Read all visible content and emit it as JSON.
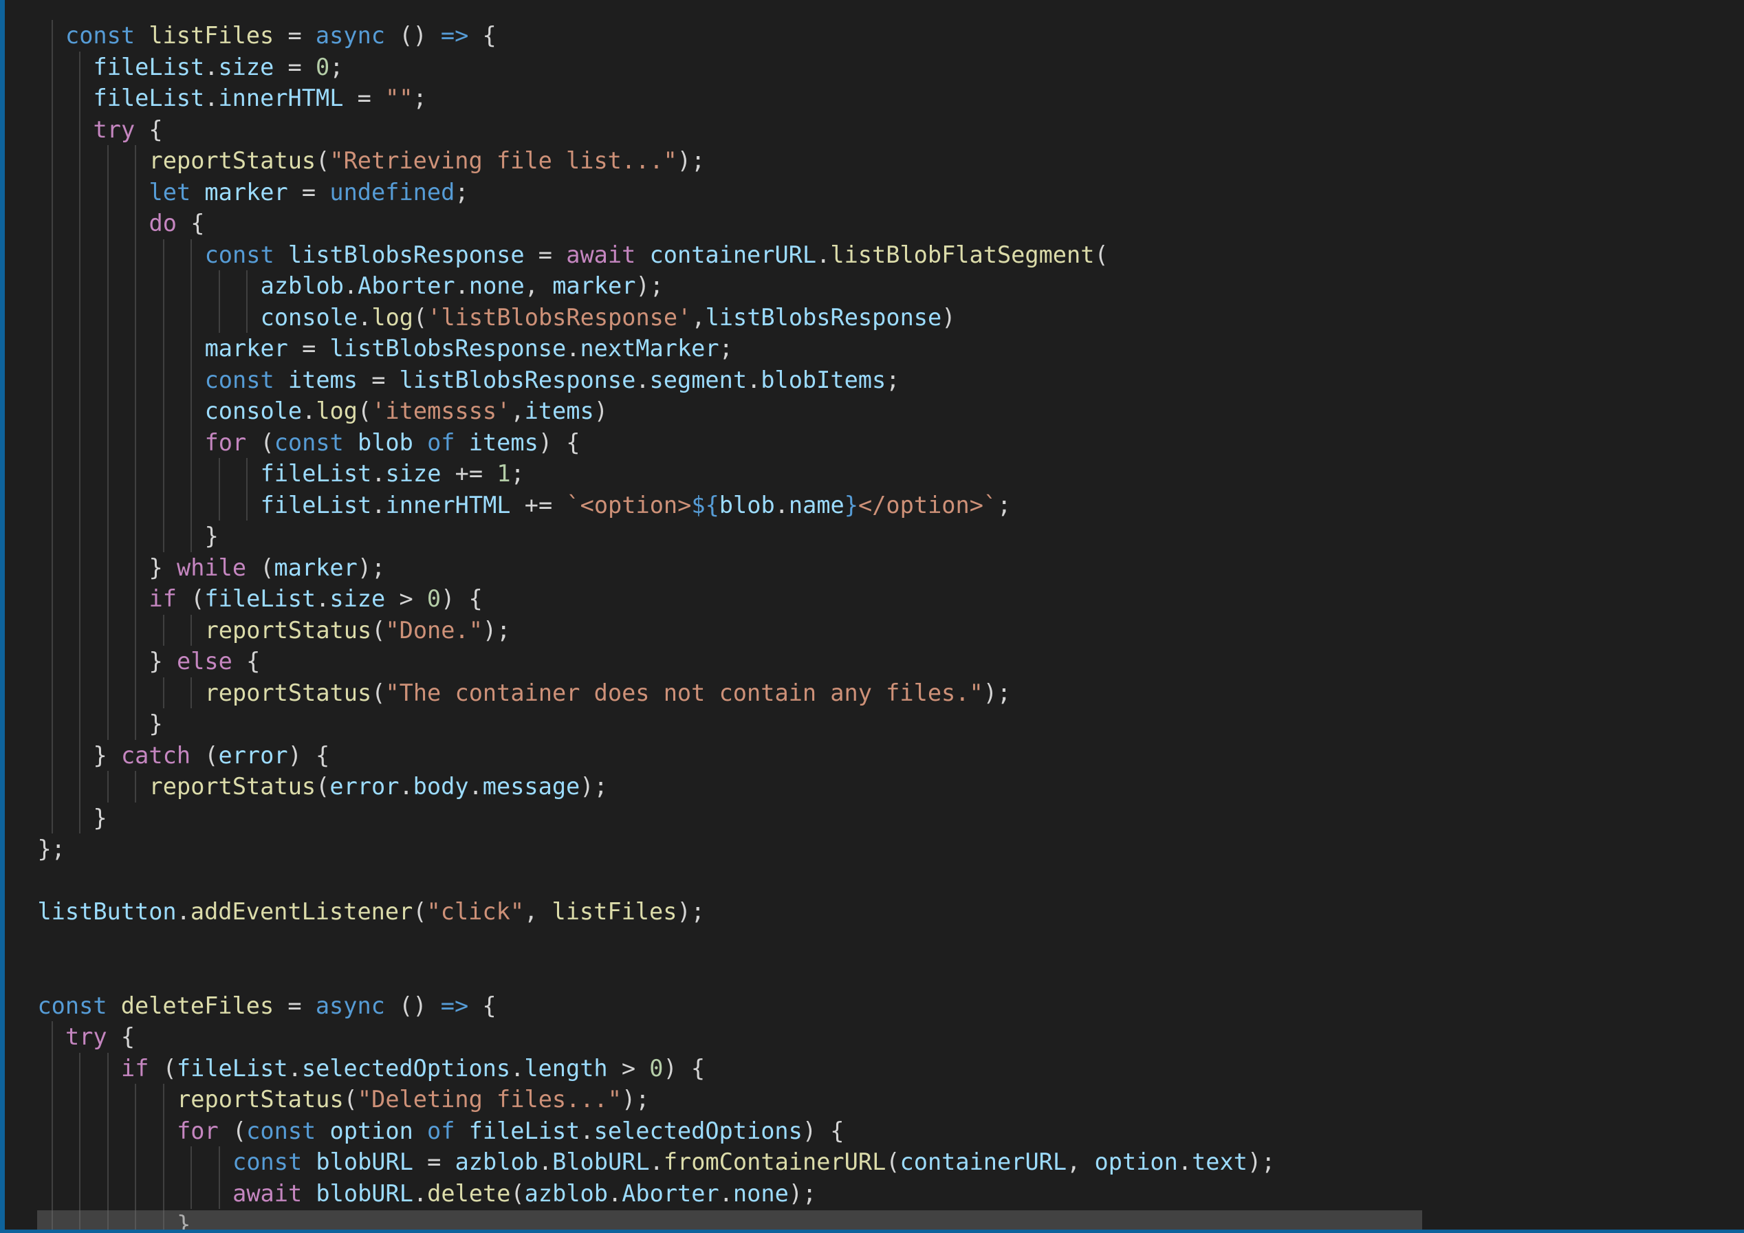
{
  "editor": {
    "language": "javascript",
    "theme": "dark",
    "colors": {
      "background": "#1e1e1e",
      "accent_border": "#0e639c",
      "keyword": "#569cd6",
      "control": "#c586c0",
      "function": "#dcdcaa",
      "variable": "#9cdcfe",
      "string": "#ce9178",
      "number": "#b5cea8",
      "punctuation": "#d4d4d4"
    },
    "lines": [
      {
        "indent": 1,
        "tokens": [
          [
            "k",
            "const"
          ],
          [
            "p",
            " "
          ],
          [
            "f",
            "listFiles"
          ],
          [
            "p",
            " = "
          ],
          [
            "k",
            "async"
          ],
          [
            "p",
            " () "
          ],
          [
            "k",
            "=>"
          ],
          [
            "p",
            " {"
          ]
        ]
      },
      {
        "indent": 2,
        "tokens": [
          [
            "v",
            "fileList"
          ],
          [
            "p",
            "."
          ],
          [
            "v",
            "size"
          ],
          [
            "p",
            " = "
          ],
          [
            "n",
            "0"
          ],
          [
            "p",
            ";"
          ]
        ]
      },
      {
        "indent": 2,
        "tokens": [
          [
            "v",
            "fileList"
          ],
          [
            "p",
            "."
          ],
          [
            "v",
            "innerHTML"
          ],
          [
            "p",
            " = "
          ],
          [
            "s",
            "\"\""
          ],
          [
            "p",
            ";"
          ]
        ]
      },
      {
        "indent": 2,
        "tokens": [
          [
            "c",
            "try"
          ],
          [
            "p",
            " {"
          ]
        ]
      },
      {
        "indent": 4,
        "tokens": [
          [
            "f",
            "reportStatus"
          ],
          [
            "p",
            "("
          ],
          [
            "s",
            "\"Retrieving file list...\""
          ],
          [
            "p",
            ");"
          ]
        ]
      },
      {
        "indent": 4,
        "tokens": [
          [
            "k",
            "let"
          ],
          [
            "p",
            " "
          ],
          [
            "v",
            "marker"
          ],
          [
            "p",
            " = "
          ],
          [
            "k",
            "undefined"
          ],
          [
            "p",
            ";"
          ]
        ]
      },
      {
        "indent": 4,
        "tokens": [
          [
            "c",
            "do"
          ],
          [
            "p",
            " {"
          ]
        ]
      },
      {
        "indent": 6,
        "tokens": [
          [
            "k",
            "const"
          ],
          [
            "p",
            " "
          ],
          [
            "v",
            "listBlobsResponse"
          ],
          [
            "p",
            " = "
          ],
          [
            "c",
            "await"
          ],
          [
            "p",
            " "
          ],
          [
            "v",
            "containerURL"
          ],
          [
            "p",
            "."
          ],
          [
            "f",
            "listBlobFlatSegment"
          ],
          [
            "p",
            "("
          ]
        ]
      },
      {
        "indent": 8,
        "tokens": [
          [
            "v",
            "azblob"
          ],
          [
            "p",
            "."
          ],
          [
            "v",
            "Aborter"
          ],
          [
            "p",
            "."
          ],
          [
            "v",
            "none"
          ],
          [
            "p",
            ", "
          ],
          [
            "v",
            "marker"
          ],
          [
            "p",
            ");"
          ]
        ]
      },
      {
        "indent": 8,
        "tokens": [
          [
            "v",
            "console"
          ],
          [
            "p",
            "."
          ],
          [
            "f",
            "log"
          ],
          [
            "p",
            "("
          ],
          [
            "s",
            "'listBlobsResponse'"
          ],
          [
            "p",
            ","
          ],
          [
            "v",
            "listBlobsResponse"
          ],
          [
            "p",
            ")"
          ]
        ]
      },
      {
        "indent": 6,
        "tokens": [
          [
            "v",
            "marker"
          ],
          [
            "p",
            " = "
          ],
          [
            "v",
            "listBlobsResponse"
          ],
          [
            "p",
            "."
          ],
          [
            "v",
            "nextMarker"
          ],
          [
            "p",
            ";"
          ]
        ]
      },
      {
        "indent": 6,
        "tokens": [
          [
            "k",
            "const"
          ],
          [
            "p",
            " "
          ],
          [
            "v",
            "items"
          ],
          [
            "p",
            " = "
          ],
          [
            "v",
            "listBlobsResponse"
          ],
          [
            "p",
            "."
          ],
          [
            "v",
            "segment"
          ],
          [
            "p",
            "."
          ],
          [
            "v",
            "blobItems"
          ],
          [
            "p",
            ";"
          ]
        ]
      },
      {
        "indent": 6,
        "tokens": [
          [
            "v",
            "console"
          ],
          [
            "p",
            "."
          ],
          [
            "f",
            "log"
          ],
          [
            "p",
            "("
          ],
          [
            "s",
            "'itemssss'"
          ],
          [
            "p",
            ","
          ],
          [
            "v",
            "items"
          ],
          [
            "p",
            ")"
          ]
        ]
      },
      {
        "indent": 6,
        "tokens": [
          [
            "c",
            "for"
          ],
          [
            "p",
            " ("
          ],
          [
            "k",
            "const"
          ],
          [
            "p",
            " "
          ],
          [
            "v",
            "blob"
          ],
          [
            "p",
            " "
          ],
          [
            "k",
            "of"
          ],
          [
            "p",
            " "
          ],
          [
            "v",
            "items"
          ],
          [
            "p",
            ") {"
          ]
        ]
      },
      {
        "indent": 8,
        "tokens": [
          [
            "v",
            "fileList"
          ],
          [
            "p",
            "."
          ],
          [
            "v",
            "size"
          ],
          [
            "p",
            " += "
          ],
          [
            "n",
            "1"
          ],
          [
            "p",
            ";"
          ]
        ]
      },
      {
        "indent": 8,
        "tokens": [
          [
            "v",
            "fileList"
          ],
          [
            "p",
            "."
          ],
          [
            "v",
            "innerHTML"
          ],
          [
            "p",
            " += "
          ],
          [
            "s",
            "`<option>"
          ],
          [
            "k",
            "${"
          ],
          [
            "v",
            "blob"
          ],
          [
            "p",
            "."
          ],
          [
            "v",
            "name"
          ],
          [
            "k",
            "}"
          ],
          [
            "s",
            "</option>`"
          ],
          [
            "p",
            ";"
          ]
        ]
      },
      {
        "indent": 6,
        "tokens": [
          [
            "p",
            "}"
          ]
        ]
      },
      {
        "indent": 4,
        "tokens": [
          [
            "p",
            "} "
          ],
          [
            "c",
            "while"
          ],
          [
            "p",
            " ("
          ],
          [
            "v",
            "marker"
          ],
          [
            "p",
            ");"
          ]
        ]
      },
      {
        "indent": 4,
        "tokens": [
          [
            "c",
            "if"
          ],
          [
            "p",
            " ("
          ],
          [
            "v",
            "fileList"
          ],
          [
            "p",
            "."
          ],
          [
            "v",
            "size"
          ],
          [
            "p",
            " > "
          ],
          [
            "n",
            "0"
          ],
          [
            "p",
            ") {"
          ]
        ]
      },
      {
        "indent": 6,
        "tokens": [
          [
            "f",
            "reportStatus"
          ],
          [
            "p",
            "("
          ],
          [
            "s",
            "\"Done.\""
          ],
          [
            "p",
            ");"
          ]
        ]
      },
      {
        "indent": 4,
        "tokens": [
          [
            "p",
            "} "
          ],
          [
            "c",
            "else"
          ],
          [
            "p",
            " {"
          ]
        ]
      },
      {
        "indent": 6,
        "tokens": [
          [
            "f",
            "reportStatus"
          ],
          [
            "p",
            "("
          ],
          [
            "s",
            "\"The container does not contain any files.\""
          ],
          [
            "p",
            ");"
          ]
        ]
      },
      {
        "indent": 4,
        "tokens": [
          [
            "p",
            "}"
          ]
        ]
      },
      {
        "indent": 2,
        "tokens": [
          [
            "p",
            "} "
          ],
          [
            "c",
            "catch"
          ],
          [
            "p",
            " ("
          ],
          [
            "v",
            "error"
          ],
          [
            "p",
            ") {"
          ]
        ]
      },
      {
        "indent": 4,
        "tokens": [
          [
            "f",
            "reportStatus"
          ],
          [
            "p",
            "("
          ],
          [
            "v",
            "error"
          ],
          [
            "p",
            "."
          ],
          [
            "v",
            "body"
          ],
          [
            "p",
            "."
          ],
          [
            "v",
            "message"
          ],
          [
            "p",
            ");"
          ]
        ]
      },
      {
        "indent": 2,
        "tokens": [
          [
            "p",
            "}"
          ]
        ]
      },
      {
        "indent": 0,
        "tokens": [
          [
            "p",
            "};"
          ]
        ]
      },
      {
        "indent": 0,
        "tokens": []
      },
      {
        "indent": 0,
        "tokens": [
          [
            "v",
            "listButton"
          ],
          [
            "p",
            "."
          ],
          [
            "f",
            "addEventListener"
          ],
          [
            "p",
            "("
          ],
          [
            "s",
            "\"click\""
          ],
          [
            "p",
            ", "
          ],
          [
            "f",
            "listFiles"
          ],
          [
            "p",
            ");"
          ]
        ]
      },
      {
        "indent": 0,
        "tokens": []
      },
      {
        "indent": 0,
        "tokens": []
      },
      {
        "indent": 0,
        "tokens": [
          [
            "k",
            "const"
          ],
          [
            "p",
            " "
          ],
          [
            "f",
            "deleteFiles"
          ],
          [
            "p",
            " = "
          ],
          [
            "k",
            "async"
          ],
          [
            "p",
            " () "
          ],
          [
            "k",
            "=>"
          ],
          [
            "p",
            " {"
          ]
        ]
      },
      {
        "indent": 1,
        "tokens": [
          [
            "c",
            "try"
          ],
          [
            "p",
            " {"
          ]
        ]
      },
      {
        "indent": 3,
        "tokens": [
          [
            "c",
            "if"
          ],
          [
            "p",
            " ("
          ],
          [
            "v",
            "fileList"
          ],
          [
            "p",
            "."
          ],
          [
            "v",
            "selectedOptions"
          ],
          [
            "p",
            "."
          ],
          [
            "v",
            "length"
          ],
          [
            "p",
            " > "
          ],
          [
            "n",
            "0"
          ],
          [
            "p",
            ") {"
          ]
        ]
      },
      {
        "indent": 5,
        "tokens": [
          [
            "f",
            "reportStatus"
          ],
          [
            "p",
            "("
          ],
          [
            "s",
            "\"Deleting files...\""
          ],
          [
            "p",
            ");"
          ]
        ]
      },
      {
        "indent": 5,
        "tokens": [
          [
            "c",
            "for"
          ],
          [
            "p",
            " ("
          ],
          [
            "k",
            "const"
          ],
          [
            "p",
            " "
          ],
          [
            "v",
            "option"
          ],
          [
            "p",
            " "
          ],
          [
            "k",
            "of"
          ],
          [
            "p",
            " "
          ],
          [
            "v",
            "fileList"
          ],
          [
            "p",
            "."
          ],
          [
            "v",
            "selectedOptions"
          ],
          [
            "p",
            ") {"
          ]
        ]
      },
      {
        "indent": 7,
        "tokens": [
          [
            "k",
            "const"
          ],
          [
            "p",
            " "
          ],
          [
            "v",
            "blobURL"
          ],
          [
            "p",
            " = "
          ],
          [
            "v",
            "azblob"
          ],
          [
            "p",
            "."
          ],
          [
            "v",
            "BlobURL"
          ],
          [
            "p",
            "."
          ],
          [
            "f",
            "fromContainerURL"
          ],
          [
            "p",
            "("
          ],
          [
            "v",
            "containerURL"
          ],
          [
            "p",
            ", "
          ],
          [
            "v",
            "option"
          ],
          [
            "p",
            "."
          ],
          [
            "v",
            "text"
          ],
          [
            "p",
            ");"
          ]
        ]
      },
      {
        "indent": 7,
        "tokens": [
          [
            "c",
            "await"
          ],
          [
            "p",
            " "
          ],
          [
            "v",
            "blobURL"
          ],
          [
            "p",
            "."
          ],
          [
            "f",
            "delete"
          ],
          [
            "p",
            "("
          ],
          [
            "v",
            "azblob"
          ],
          [
            "p",
            "."
          ],
          [
            "v",
            "Aborter"
          ],
          [
            "p",
            "."
          ],
          [
            "v",
            "none"
          ],
          [
            "p",
            ");"
          ]
        ]
      },
      {
        "indent": 5,
        "tokens": [
          [
            "p",
            "}"
          ]
        ]
      }
    ]
  }
}
